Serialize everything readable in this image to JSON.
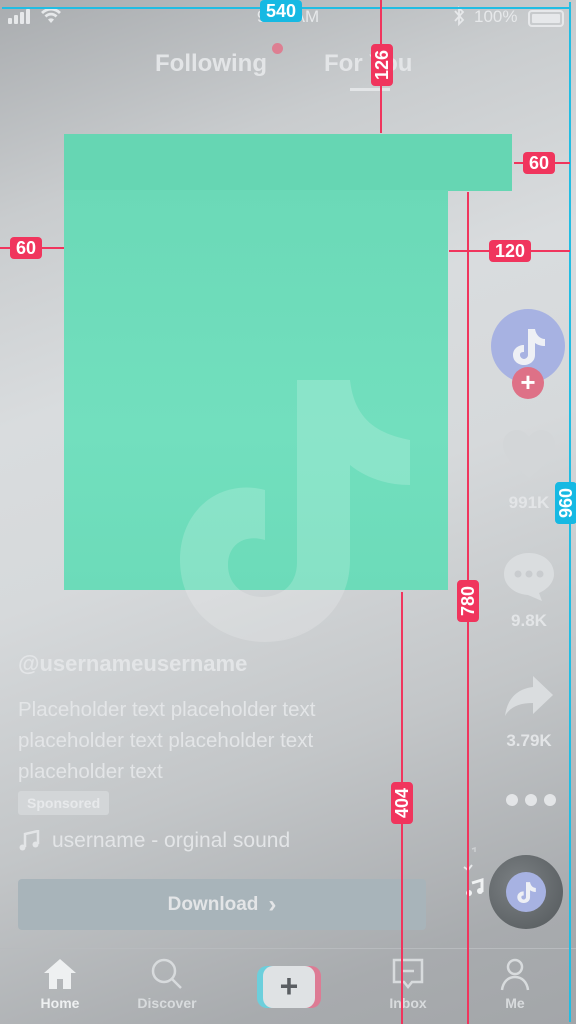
{
  "status_bar": {
    "time": "9:41 AM",
    "battery": "100%",
    "icons": [
      "signal-icon",
      "wifi-icon",
      "bluetooth-icon",
      "battery-icon"
    ]
  },
  "top_tabs": [
    {
      "label": "Following",
      "has_notification_dot": true
    },
    {
      "label": "For You",
      "active": true
    }
  ],
  "actions": {
    "follow_label": "+",
    "likes": "991K",
    "comments": "9.8K",
    "shares": "3.79K"
  },
  "post": {
    "username": "@usernameusername",
    "caption": "Placeholder text placeholder text placeholder text placeholder text placeholder text",
    "sponsored_label": "Sponsored",
    "sound": "username - orginal sound",
    "download_label": "Download",
    "download_chevron": "›"
  },
  "bottom_nav": {
    "items": [
      {
        "label": "Home",
        "icon": "home-icon",
        "active": true
      },
      {
        "label": "Discover",
        "icon": "search-icon"
      },
      {
        "label": "",
        "icon": "create-icon"
      },
      {
        "label": "Inbox",
        "icon": "inbox-icon"
      },
      {
        "label": "Me",
        "icon": "profile-icon"
      }
    ],
    "create_label": "+"
  },
  "measurements": {
    "width_total": "540",
    "height_total": "960",
    "top_offset": "126",
    "left_margin": "60",
    "right_margin_top": "60",
    "right_margin": "120",
    "content_height": "780",
    "bottom_offset": "404"
  },
  "colors": {
    "content_green": "#6bd9b7",
    "avatar_lavender": "#a7b2e2",
    "follow_pink": "#de7187",
    "measure_red": "#f0355d",
    "measure_cyan": "#16b9e3"
  }
}
